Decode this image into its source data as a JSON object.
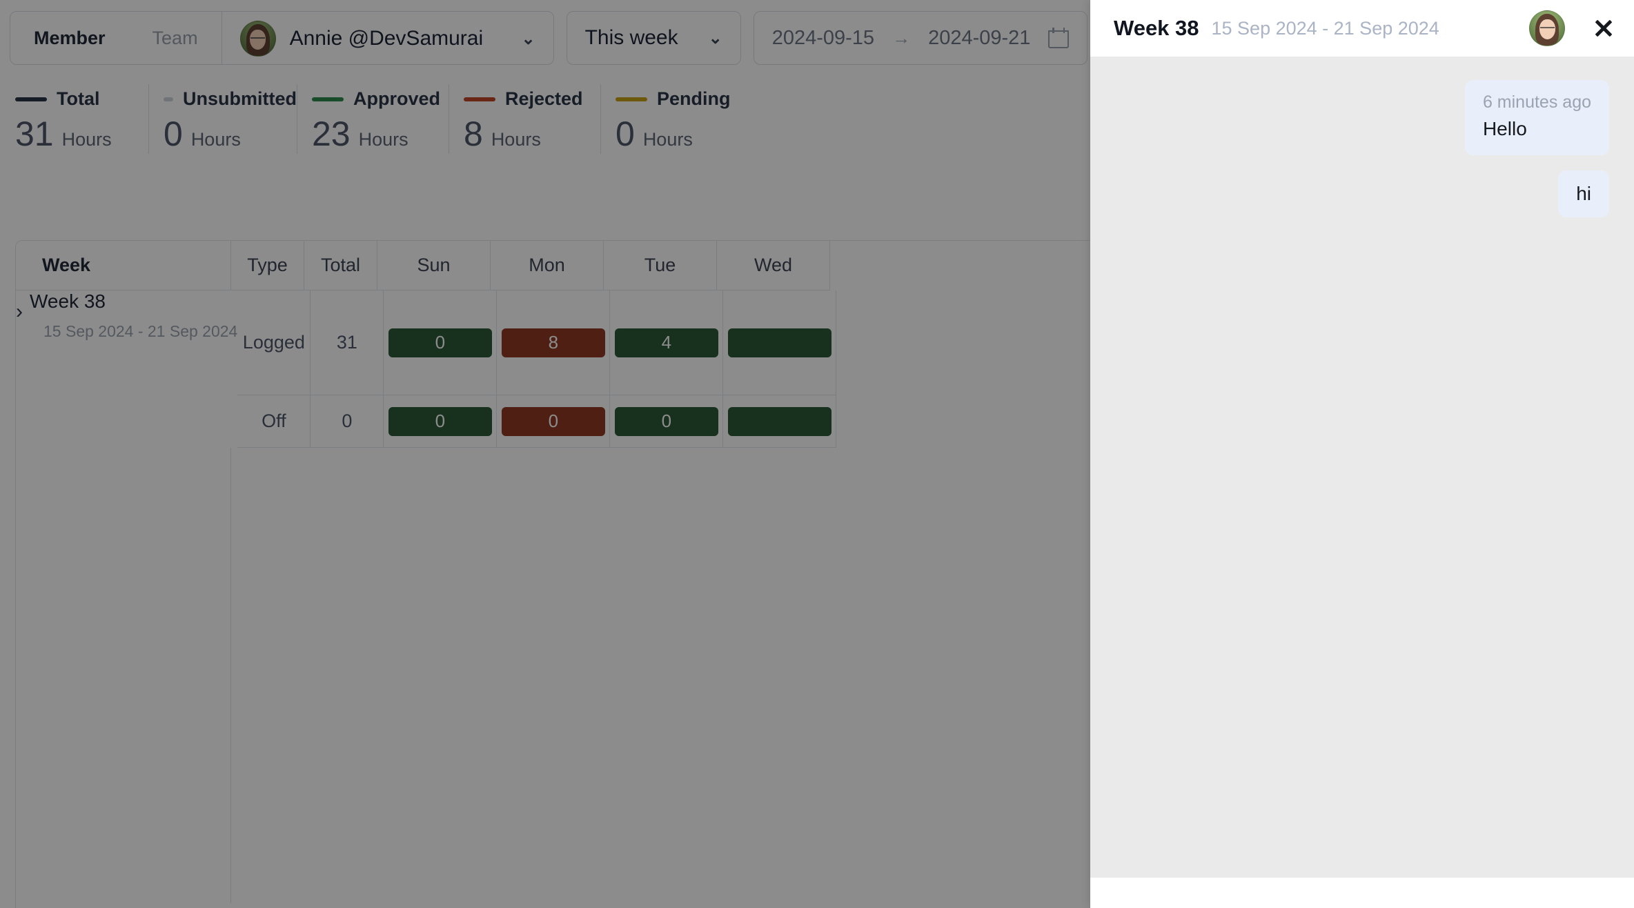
{
  "toolbar": {
    "tabs": [
      {
        "label": "Member",
        "active": true
      },
      {
        "label": "Team",
        "active": false
      }
    ],
    "member_select": {
      "name": "Annie @DevSamurai",
      "chevron": "chevron-down"
    },
    "period_select": {
      "value": "This week",
      "chevron": "chevron-down"
    },
    "date_range": {
      "start": "2024-09-15",
      "arrow": "→",
      "end": "2024-09-21",
      "icon": "calendar-icon"
    }
  },
  "stats": [
    {
      "label": "Total",
      "value": "31",
      "unit": "Hours",
      "color": "#2b3547"
    },
    {
      "label": "Unsubmitted",
      "value": "0",
      "unit": "Hours",
      "color": "#cdd2d9"
    },
    {
      "label": "Approved",
      "value": "23",
      "unit": "Hours",
      "color": "#2e8a4f"
    },
    {
      "label": "Rejected",
      "value": "8",
      "unit": "Hours",
      "color": "#c24527"
    },
    {
      "label": "Pending",
      "value": "0",
      "unit": "Hours",
      "color": "#c9a015"
    }
  ],
  "table": {
    "headers": {
      "week": "Week",
      "type": "Type",
      "total": "Total",
      "days": [
        "Sun",
        "Mon",
        "Tue",
        "Wed"
      ]
    },
    "rows": [
      {
        "week_name": "Week 38",
        "week_range": "15 Sep 2024 - 21 Sep 2024",
        "expander": "chevron-right",
        "entries": [
          {
            "type": "Logged",
            "total": "31",
            "days": [
              {
                "value": "0",
                "color": "#2b5a38"
              },
              {
                "value": "8",
                "color": "#8e3a22"
              },
              {
                "value": "4",
                "color": "#2b5a38"
              },
              {
                "value": "",
                "color": "#2b5a38"
              }
            ]
          },
          {
            "type": "Off",
            "total": "0",
            "days": [
              {
                "value": "0",
                "color": "#2b5a38"
              },
              {
                "value": "0",
                "color": "#8e3a22"
              },
              {
                "value": "0",
                "color": "#2b5a38"
              },
              {
                "value": "",
                "color": "#2b5a38"
              }
            ]
          }
        ]
      }
    ]
  },
  "chat_panel": {
    "title": "Week 38",
    "subtitle": "15 Sep 2024 - 21 Sep 2024",
    "avatar": "user-avatar",
    "close": "close-icon",
    "messages": [
      {
        "time": "6 minutes ago",
        "text": "Hello"
      },
      {
        "time": "",
        "text": "hi"
      }
    ]
  }
}
